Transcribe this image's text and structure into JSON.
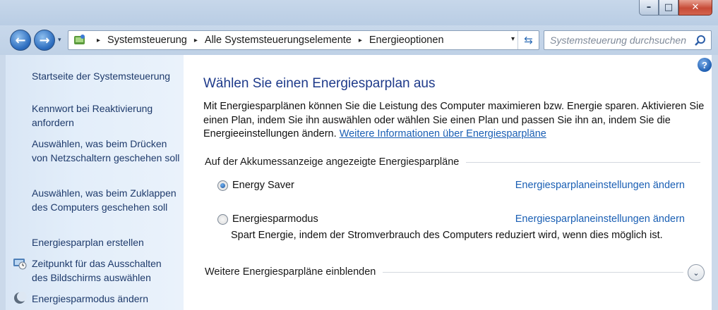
{
  "window": {
    "minimize": "–",
    "maximize": "□",
    "close": "✕"
  },
  "nav": {
    "back": "←",
    "forward": "→",
    "recent": "▾",
    "breadcrumbs": [
      "Systemsteuerung",
      "Alle Systemsteuerungselemente",
      "Energieoptionen"
    ],
    "separator": "▸",
    "dropdown": "▾",
    "refresh": "⇆",
    "search_placeholder": "Systemsteuerung durchsuchen"
  },
  "sidebar": {
    "items": [
      {
        "label": "Startseite der Systemsteuerung"
      },
      {
        "label": "Kennwort bei Reaktivierung anfordern"
      },
      {
        "label": "Auswählen, was beim Drücken von Netzschaltern geschehen soll"
      },
      {
        "label": "Auswählen, was beim Zuklappen des Computers geschehen soll"
      },
      {
        "label": "Energiesparplan erstellen"
      },
      {
        "label": "Zeitpunkt für das Ausschalten des Bildschirms auswählen",
        "icon": "monitor-clock-icon"
      },
      {
        "label": "Energiesparmodus ändern",
        "icon": "moon-icon"
      }
    ]
  },
  "main": {
    "help": "?",
    "title": "Wählen Sie einen Energiesparplan aus",
    "description": "Mit Energiesparplänen können Sie die Leistung des Computer maximieren bzw. Energie sparen. Aktivieren Sie einen Plan, indem Sie ihn auswählen oder wählen Sie einen Plan und passen Sie ihn an, indem Sie die Energieeinstellungen ändern.",
    "more_info_link": "Weitere Informationen über Energiesparpläne",
    "group_label": "Auf der Akkumessanzeige angezeigte Energiesparpläne",
    "plans": [
      {
        "name": "Energy Saver",
        "selected": true,
        "change_link": "Energiesparplaneinstellungen ändern"
      },
      {
        "name": "Energiesparmodus",
        "selected": false,
        "change_link": "Energiesparplaneinstellungen ändern",
        "description": "Spart Energie, indem der Stromverbrauch des Computers reduziert wird, wenn dies möglich ist."
      }
    ],
    "more_plans_label": "Weitere Energiesparpläne einblenden",
    "expand": "⌄"
  },
  "colors": {
    "title": "#1e3a8a",
    "link": "#1a5fb4",
    "sidebar_link": "#1e3a6b",
    "frame": "#c8d8eb"
  }
}
